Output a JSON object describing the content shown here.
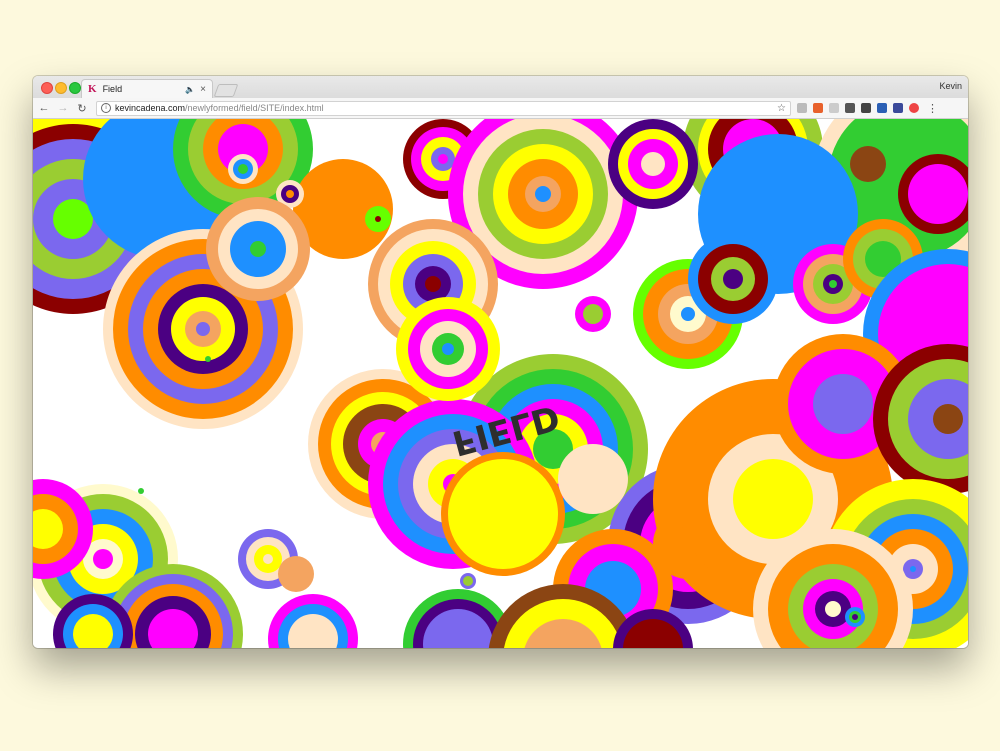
{
  "browser": {
    "tab_title": "Field",
    "tab_favicon": "K",
    "profile_name": "Kevin",
    "url_host": "kevincadena.com",
    "url_path": "/newlyformed/field/SITE/index.html",
    "icons": [
      "back-icon",
      "forward-icon",
      "reload-icon",
      "info-icon",
      "star-icon",
      "menu-icon"
    ]
  },
  "page": {
    "logo_text": "FIELD"
  },
  "colors": {
    "background": "#fdf9dd",
    "magenta": "#ff00ff",
    "yellow": "#ffff00",
    "orange": "#ff8c00",
    "green": "#32cd32",
    "lime": "#66ff00",
    "blue": "#1e90ff",
    "purple": "#7b68ee",
    "indigo": "#4b0082",
    "maroon": "#8b0000",
    "brown": "#8b4513",
    "sandy": "#f4a460",
    "bisque": "#ffe4c4",
    "olive": "#9acd32",
    "cream": "#fffacd"
  }
}
